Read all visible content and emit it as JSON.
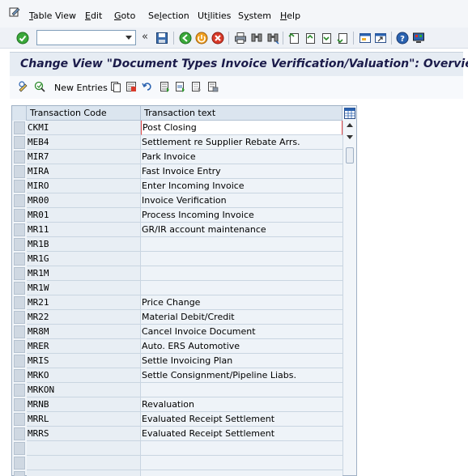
{
  "menubar": {
    "items": [
      "Table View",
      "Edit",
      "Goto",
      "Selection",
      "Utilities",
      "System",
      "Help"
    ],
    "mnemonics": [
      "T",
      "E",
      "G",
      "l",
      "i",
      "y",
      "H"
    ]
  },
  "toolbar": {
    "command_field_value": "",
    "icons": [
      "enter-icon",
      "save-icon",
      "back-icon",
      "exit-icon",
      "cancel-icon",
      "print-icon",
      "find-icon",
      "find-next-icon",
      "first-page-icon",
      "previous-page-icon",
      "next-page-icon",
      "last-page-icon",
      "create-session-icon",
      "shortcut-icon",
      "help-icon",
      "layout-menu-icon"
    ]
  },
  "header": {
    "title": "Change View \"Document Types Invoice Verification/Valuation\": Overview"
  },
  "app_toolbar": {
    "new_entries_label": "New Entries",
    "icons": [
      "change-display-icon",
      "refresh-icon",
      "new-entries-icon",
      "copy-as-icon",
      "delete-icon",
      "undo-icon",
      "select-all-icon",
      "select-block-icon",
      "deselect-all-icon",
      "print-field-list-icon"
    ]
  },
  "table": {
    "columns": [
      "Transaction Code",
      "Transaction text"
    ],
    "rows": [
      {
        "code": "CKMI",
        "text": "Post Closing"
      },
      {
        "code": "MEB4",
        "text": "Settlement re Supplier Rebate Arrs."
      },
      {
        "code": "MIR7",
        "text": "Park Invoice"
      },
      {
        "code": "MIRA",
        "text": "Fast Invoice Entry"
      },
      {
        "code": "MIRO",
        "text": "Enter Incoming Invoice"
      },
      {
        "code": "MR00",
        "text": "Invoice Verification"
      },
      {
        "code": "MR01",
        "text": "Process Incoming Invoice"
      },
      {
        "code": "MR11",
        "text": "GR/IR account maintenance"
      },
      {
        "code": "MR1B",
        "text": ""
      },
      {
        "code": "MR1G",
        "text": ""
      },
      {
        "code": "MR1M",
        "text": ""
      },
      {
        "code": "MR1W",
        "text": ""
      },
      {
        "code": "MR21",
        "text": "Price Change"
      },
      {
        "code": "MR22",
        "text": "Material Debit/Credit"
      },
      {
        "code": "MR8M",
        "text": "Cancel Invoice Document"
      },
      {
        "code": "MRER",
        "text": "Auto. ERS Automotive"
      },
      {
        "code": "MRIS",
        "text": "Settle Invoicing Plan"
      },
      {
        "code": "MRKO",
        "text": "Settle Consignment/Pipeline Liabs."
      },
      {
        "code": "MRKON",
        "text": ""
      },
      {
        "code": "MRNB",
        "text": "Revaluation"
      },
      {
        "code": "MRRL",
        "text": "Evaluated Receipt Settlement"
      },
      {
        "code": "MRRS",
        "text": "Evaluated Receipt Settlement"
      },
      {
        "code": "",
        "text": ""
      },
      {
        "code": "",
        "text": ""
      },
      {
        "code": "",
        "text": ""
      }
    ]
  },
  "colors": {
    "title_text": "#1b1b4a",
    "header_bg": "#dbe5ef",
    "selection_marker": "#e04848"
  }
}
